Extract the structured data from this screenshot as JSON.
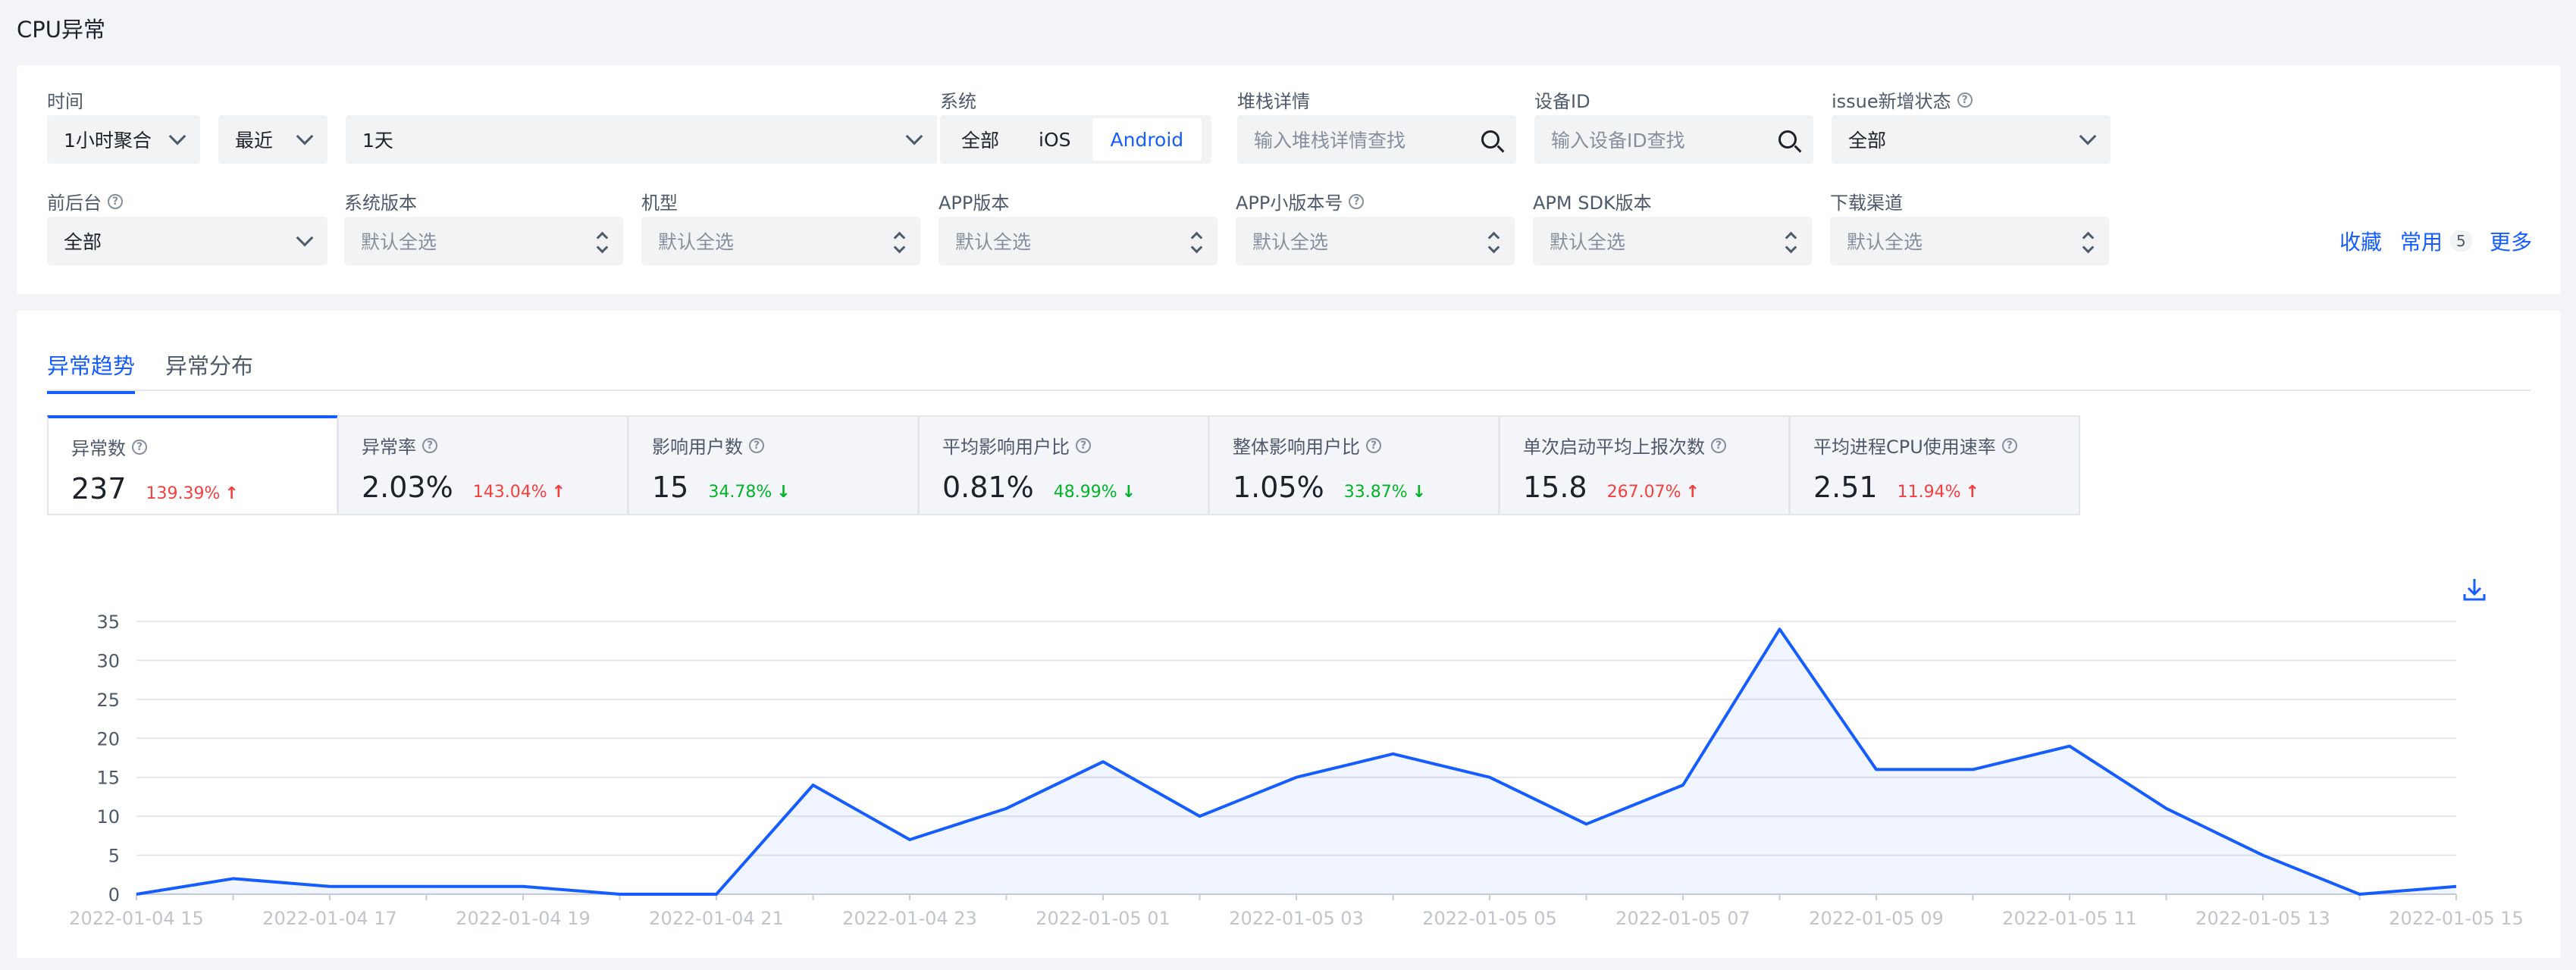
{
  "page_title": "CPU异常",
  "filters": {
    "time": {
      "label": "时间",
      "aggregate": "1小时聚合",
      "recent": "最近",
      "range": "1天"
    },
    "system": {
      "label": "系统",
      "options": [
        "全部",
        "iOS",
        "Android"
      ],
      "active": "Android"
    },
    "stack": {
      "label": "堆栈详情",
      "placeholder": "输入堆栈详情查找"
    },
    "device": {
      "label": "设备ID",
      "placeholder": "输入设备ID查找"
    },
    "issue_status": {
      "label": "issue新增状态",
      "value": "全部"
    },
    "foreground": {
      "label": "前后台",
      "value": "全部"
    },
    "os_version": {
      "label": "系统版本",
      "placeholder": "默认全选"
    },
    "model": {
      "label": "机型",
      "placeholder": "默认全选"
    },
    "app_version": {
      "label": "APP版本",
      "placeholder": "默认全选"
    },
    "app_minor": {
      "label": "APP小版本号",
      "placeholder": "默认全选"
    },
    "sdk_version": {
      "label": "APM SDK版本",
      "placeholder": "默认全选"
    },
    "channel": {
      "label": "下载渠道",
      "placeholder": "默认全选"
    },
    "actions": {
      "favorite": "收藏",
      "common": "常用",
      "common_count": "5",
      "more": "更多"
    }
  },
  "tabs": [
    "异常趋势",
    "异常分布"
  ],
  "metrics": [
    {
      "title": "异常数",
      "value": "237",
      "change": "139.39%",
      "dir": "up"
    },
    {
      "title": "异常率",
      "value": "2.03%",
      "change": "143.04%",
      "dir": "up"
    },
    {
      "title": "影响用户数",
      "value": "15",
      "change": "34.78%",
      "dir": "down"
    },
    {
      "title": "平均影响用户比",
      "value": "0.81%",
      "change": "48.99%",
      "dir": "down"
    },
    {
      "title": "整体影响用户比",
      "value": "1.05%",
      "change": "33.87%",
      "dir": "down"
    },
    {
      "title": "单次启动平均上报次数",
      "value": "15.8",
      "change": "267.07%",
      "dir": "up"
    },
    {
      "title": "平均进程CPU使用速率",
      "value": "2.51",
      "change": "11.94%",
      "dir": "up"
    }
  ],
  "colors": {
    "accent": "#165dff",
    "up": "#f53f3f",
    "down": "#00b42a"
  },
  "chart_data": {
    "type": "line",
    "x": [
      "2022-01-04 15",
      "2022-01-04 16",
      "2022-01-04 17",
      "2022-01-04 18",
      "2022-01-04 19",
      "2022-01-04 20",
      "2022-01-04 21",
      "2022-01-04 22",
      "2022-01-04 23",
      "2022-01-05 00",
      "2022-01-05 01",
      "2022-01-05 02",
      "2022-01-05 03",
      "2022-01-05 04",
      "2022-01-05 05",
      "2022-01-05 06",
      "2022-01-05 07",
      "2022-01-05 08",
      "2022-01-05 09",
      "2022-01-05 10",
      "2022-01-05 11",
      "2022-01-05 12",
      "2022-01-05 13",
      "2022-01-05 14",
      "2022-01-05 15"
    ],
    "series": [
      {
        "values": [
          0,
          2,
          1,
          1,
          1,
          0,
          0,
          14,
          7,
          11,
          17,
          10,
          15,
          18,
          15,
          9,
          14,
          34,
          16,
          16,
          19,
          11,
          5,
          0,
          1
        ]
      }
    ],
    "tick_labels": [
      "2022-01-04 15",
      "2022-01-04 17",
      "2022-01-04 19",
      "2022-01-04 21",
      "2022-01-04 23",
      "2022-01-05 01",
      "2022-01-05 03",
      "2022-01-05 05",
      "2022-01-05 07",
      "2022-01-05 09",
      "2022-01-05 11",
      "2022-01-05 13",
      "2022-01-05 15"
    ],
    "yticks": [
      0,
      5,
      10,
      15,
      20,
      25,
      30,
      35
    ],
    "ylim": [
      0,
      35
    ],
    "grid": true
  }
}
